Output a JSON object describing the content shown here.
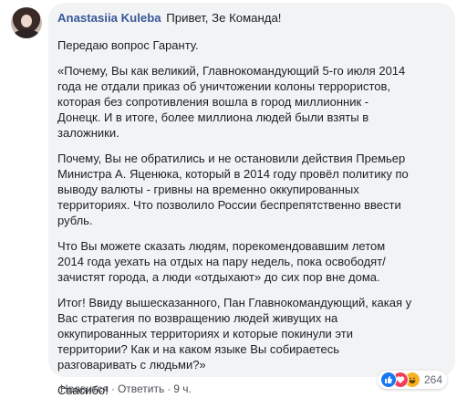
{
  "comment": {
    "author": "Anastasiia Kuleba",
    "greeting": "Привет, Зе Команда!",
    "paragraphs": [
      "Передаю вопрос Гаранту.",
      "«Почему, Вы как великий, Главнокомандующий 5-го июля 2014\nгода не отдали приказ об уничтожении колоны террористов,\nкоторая без сопротивления вошла в город миллионник -\nДонецк. И в итоге, более миллиона людей были взяты в\nзаложники.",
      "Почему, Вы не обратились и не остановили действия Премьер\nМинистра А. Яценюка, который в 2014 году провёл политику по\nвыводу валюты - гривны на временно оккупированных\nтерриториях. Что позволило России беспрепятственно ввести\nрубль.",
      "Что Вы можете сказать людям, порекомендовавшим летом\n2014 года уехать на отдых на пару недель, пока освободят/\nзачистят города, а люди «отдыхают» до сих пор вне дома.",
      "Итог! Ввиду вышесказанного, Пан Главнокомандующий, какая у\nВас стратегия по возвращению людей живущих на\nоккупированных территориях и которые покинули эти\nтерритории? Как и на каком языке Вы собираетесь\nразговаривать с людьми?»",
      "Спасибо!"
    ],
    "reactions": {
      "icons": [
        "like-icon",
        "love-icon",
        "haha-icon"
      ],
      "count": "264"
    },
    "actions": {
      "like": "Нравится",
      "reply": "Ответить",
      "time": "9 ч.",
      "separator": "·"
    }
  },
  "colors": {
    "author": "#385898",
    "bubble": "#f2f3f5",
    "like": "#1877f2",
    "love": "#f33e58",
    "haha": "#f7b125"
  }
}
